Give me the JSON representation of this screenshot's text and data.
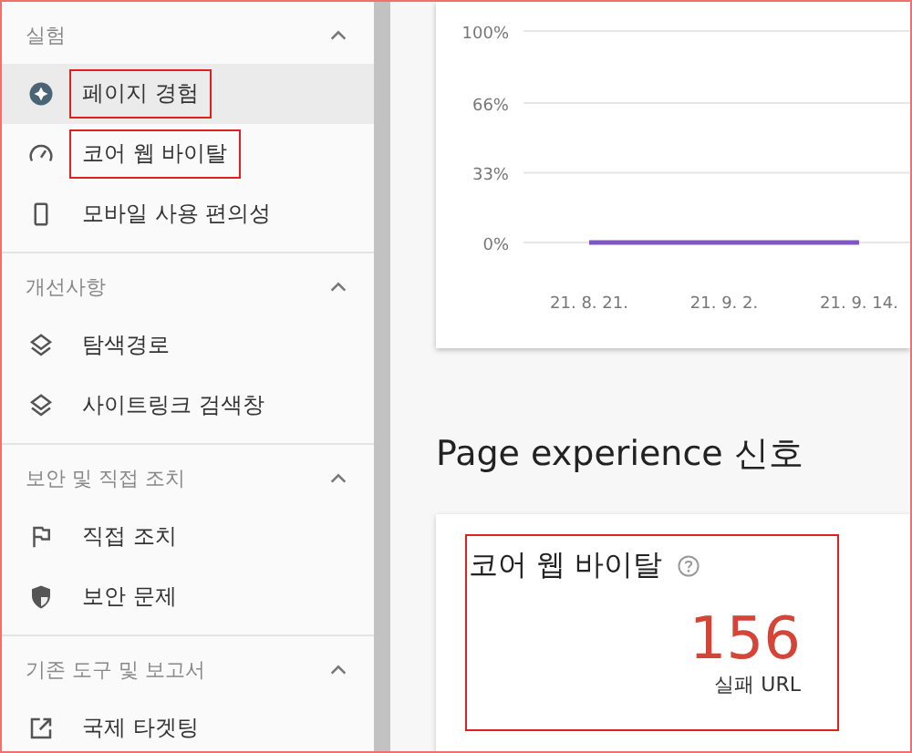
{
  "sidebar": {
    "sections": [
      {
        "title": "실험",
        "expanded": true,
        "items": [
          {
            "label": "페이지 경험",
            "kind": "experience",
            "selected": true,
            "highlighted": true
          },
          {
            "label": "코어 웹 바이탈",
            "kind": "vitals",
            "selected": false,
            "highlighted": true
          },
          {
            "label": "모바일 사용 편의성",
            "kind": "mobile",
            "selected": false,
            "highlighted": false
          }
        ]
      },
      {
        "title": "개선사항",
        "expanded": true,
        "items": [
          {
            "label": "탐색경로",
            "kind": "enhancement",
            "selected": false,
            "highlighted": false
          },
          {
            "label": "사이트링크 검색창",
            "kind": "enhancement",
            "selected": false,
            "highlighted": false
          }
        ]
      },
      {
        "title": "보안 및 직접 조치",
        "expanded": true,
        "items": [
          {
            "label": "직접 조치",
            "kind": "manual",
            "selected": false,
            "highlighted": false
          },
          {
            "label": "보안 문제",
            "kind": "security",
            "selected": false,
            "highlighted": false
          }
        ]
      },
      {
        "title": "기존 도구 및 보고서",
        "expanded": true,
        "items": [
          {
            "label": "국제 타겟팅",
            "kind": "legacy",
            "selected": false,
            "highlighted": false
          }
        ]
      }
    ]
  },
  "chart": {
    "chart_data": {
      "type": "line",
      "categories": [
        "21. 8. 21.",
        "21. 9. 2.",
        "21. 9. 14."
      ],
      "yticks": [
        {
          "value": 0,
          "label": "0%"
        },
        {
          "value": 33,
          "label": "33%"
        },
        {
          "value": 66,
          "label": "66%"
        },
        {
          "value": 100,
          "label": "100%"
        }
      ],
      "ylim": [
        0,
        100
      ],
      "series": [
        {
          "color": "#7e57c2",
          "values": [
            0,
            0,
            0
          ]
        }
      ]
    }
  },
  "section_heading": "Page experience 신호",
  "metric_card": {
    "title": "코어 웹 바이탈",
    "highlighted": true,
    "value": "156",
    "caption": "실패 URL"
  }
}
